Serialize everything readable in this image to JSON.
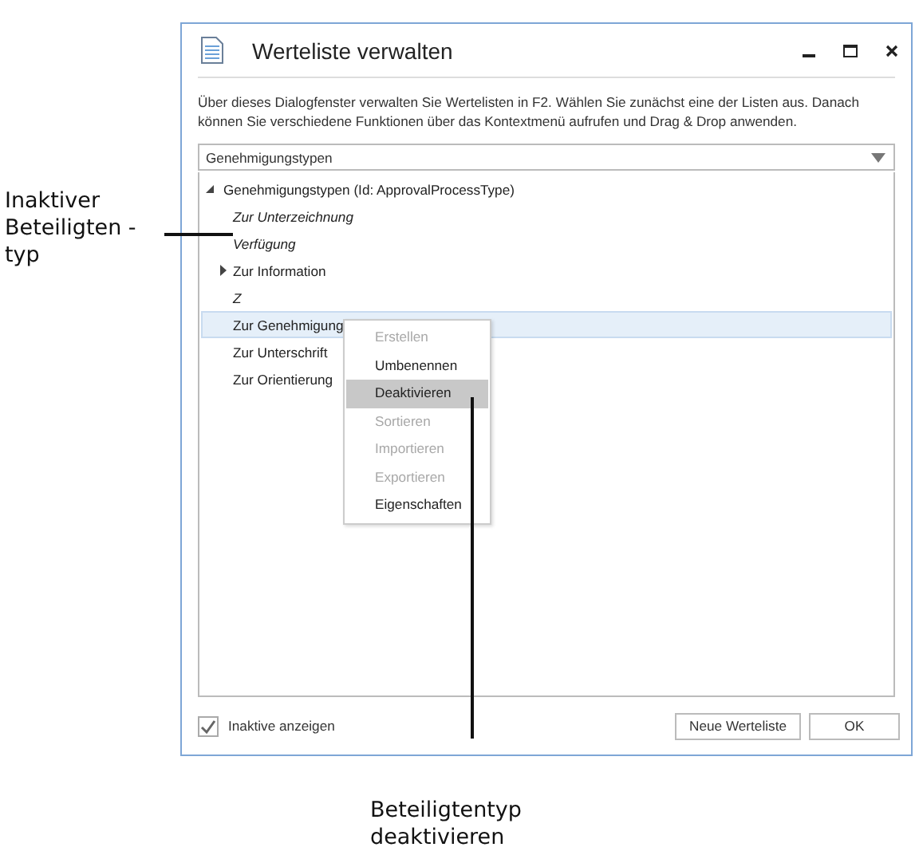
{
  "window": {
    "title": "Werteliste verwalten"
  },
  "description": "Über dieses Dialogfenster verwalten Sie Wertelisten in F2. Wählen Sie zunächst eine der Listen aus. Danach können Sie verschiedene Funktionen über das Kontextmenü aufrufen und Drag & Drop anwenden.",
  "list_select": {
    "value": "Genehmigungstypen"
  },
  "tree": {
    "label": "Genehmigungstypen (Id: ApprovalProcessType)",
    "expanded": true,
    "children": [
      {
        "label": "Zur Unterzeichnung",
        "inactive": true,
        "selected": false
      },
      {
        "label": "Verfügung",
        "inactive": true,
        "selected": false
      },
      {
        "label": "Zur Information",
        "inactive": false,
        "selected": false,
        "expanded": false
      },
      {
        "label": "Z",
        "inactive": true,
        "selected": false
      },
      {
        "label": "Zur Genehmigung",
        "inactive": false,
        "selected": true
      },
      {
        "label": "Zur Unterschrift",
        "inactive": false,
        "selected": false
      },
      {
        "label": "Zur Orientierung",
        "inactive": false,
        "selected": false
      }
    ]
  },
  "context_menu": [
    {
      "label": "Erstellen",
      "disabled": true,
      "selected": false
    },
    {
      "label": "Umbenennen",
      "disabled": false,
      "selected": false
    },
    {
      "label": "Deaktivieren",
      "disabled": false,
      "selected": true
    },
    {
      "label": "Sortieren",
      "disabled": true,
      "selected": false
    },
    {
      "label": "Importieren",
      "disabled": true,
      "selected": false
    },
    {
      "label": "Exportieren",
      "disabled": true,
      "selected": false
    },
    {
      "label": "Eigenschaften",
      "disabled": false,
      "selected": false
    }
  ],
  "show_inactive": {
    "label": "Inaktive anzeigen",
    "checked": true
  },
  "buttons": [
    "Neue Werteliste",
    "OK"
  ],
  "callouts": [
    "Inaktiver Beteiligten -typ",
    "Beteiligtentyp deaktivieren"
  ]
}
